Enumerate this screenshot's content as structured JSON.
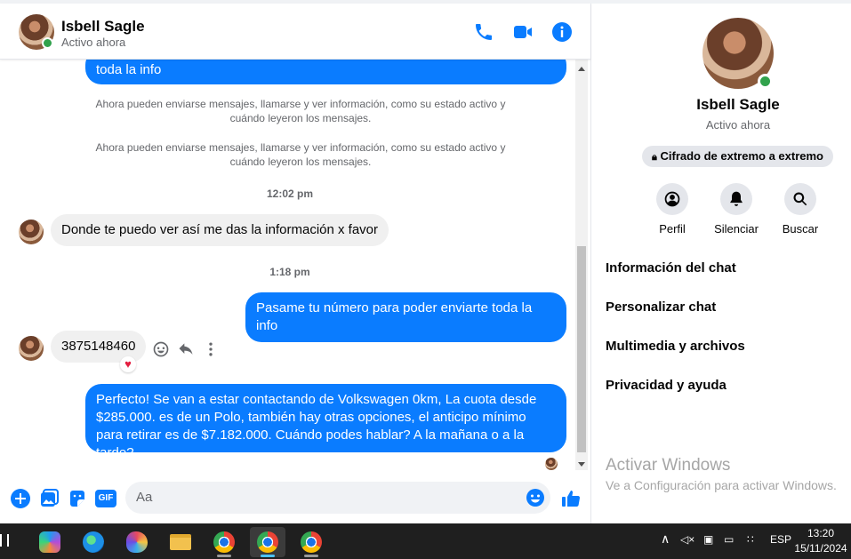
{
  "header": {
    "name": "Isbell Sagle",
    "status": "Activo ahora"
  },
  "messages": {
    "top_fragment": "toda la info",
    "system_1": "Ahora pueden enviarse mensajes, llamarse y ver información, como su estado activo y cuándo leyeron los mensajes.",
    "system_2": "Ahora pueden enviarse mensajes, llamarse y ver información, como su estado activo y cuándo leyeron los mensajes.",
    "time_1": "12:02 pm",
    "in_1": "Donde te puedo ver así me das la información  x favor",
    "time_2": "1:18 pm",
    "out_1": "Pasame tu número para poder enviarte toda la info",
    "in_2": "3875148460",
    "in_2_reaction": "♥",
    "out_2": "Perfecto!  Se van a estar contactando de Volkswagen 0km, La cuota desde $285.000. es de un Polo, también hay otras opciones, el anticipo mínimo para retirar es de $7.182.000. Cuándo podes hablar? A la mañana o a la tarde?"
  },
  "composer": {
    "placeholder": "Aa",
    "gif_label": "GIF"
  },
  "info": {
    "name": "Isbell Sagle",
    "status": "Activo ahora",
    "encryption": "Cifrado de extremo a extremo",
    "buttons": [
      "Perfil",
      "Silenciar",
      "Buscar"
    ],
    "rows": [
      "Información del chat",
      "Personalizar chat",
      "Multimedia y archivos",
      "Privacidad y ayuda"
    ]
  },
  "watermark": {
    "title": "Activar Windows",
    "subtitle": "Ve a Configuración para activar Windows."
  },
  "taskbar": {
    "language": "ESP",
    "time": "13:20",
    "date": "15/11/2024"
  },
  "colors": {
    "accent": "#0a7cff",
    "online": "#31a24c",
    "reaction": "#e41e3f"
  }
}
